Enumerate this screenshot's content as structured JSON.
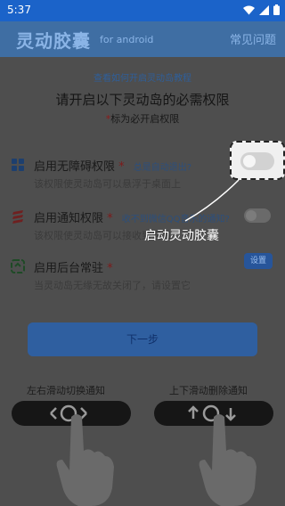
{
  "status_bar": {
    "time": "5:37"
  },
  "app_bar": {
    "title": "灵动胶囊",
    "subtitle": "for android",
    "faq_label": "常见问题"
  },
  "intro": {
    "tutorial_link": "查看如何开启灵动岛教程",
    "heading": "请开启以下灵动岛的必需权限",
    "required_star": "*",
    "required_note": "标为必开启权限"
  },
  "permissions": [
    {
      "title": "启用无障碍权限",
      "star": "*",
      "link": "总是自动退出?",
      "description": "该权限使灵动岛可以悬浮于桌面上",
      "toggle_on": false
    },
    {
      "title": "启用通知权限",
      "star": "*",
      "link": "收不到微信QQ音乐的通知?",
      "description": "该权限使灵动岛可以接收到通知",
      "toggle_on": false
    },
    {
      "title": "启用后台常驻",
      "star": "*",
      "description": "当灵动岛无缘无故关闭了，请设置它",
      "button": "设置"
    }
  ],
  "next_button": "下一步",
  "gesture_hints": [
    {
      "label": "左右滑动切换通知"
    },
    {
      "label": "上下滑动删除通知"
    }
  ],
  "overlay": {
    "caption": "启动灵动胶囊"
  },
  "colors": {
    "status_bar": "#1b63c9",
    "app_bar": "#3f6ea3",
    "dim_background": "#4e4e4e",
    "accent": "#2f5fa0"
  }
}
